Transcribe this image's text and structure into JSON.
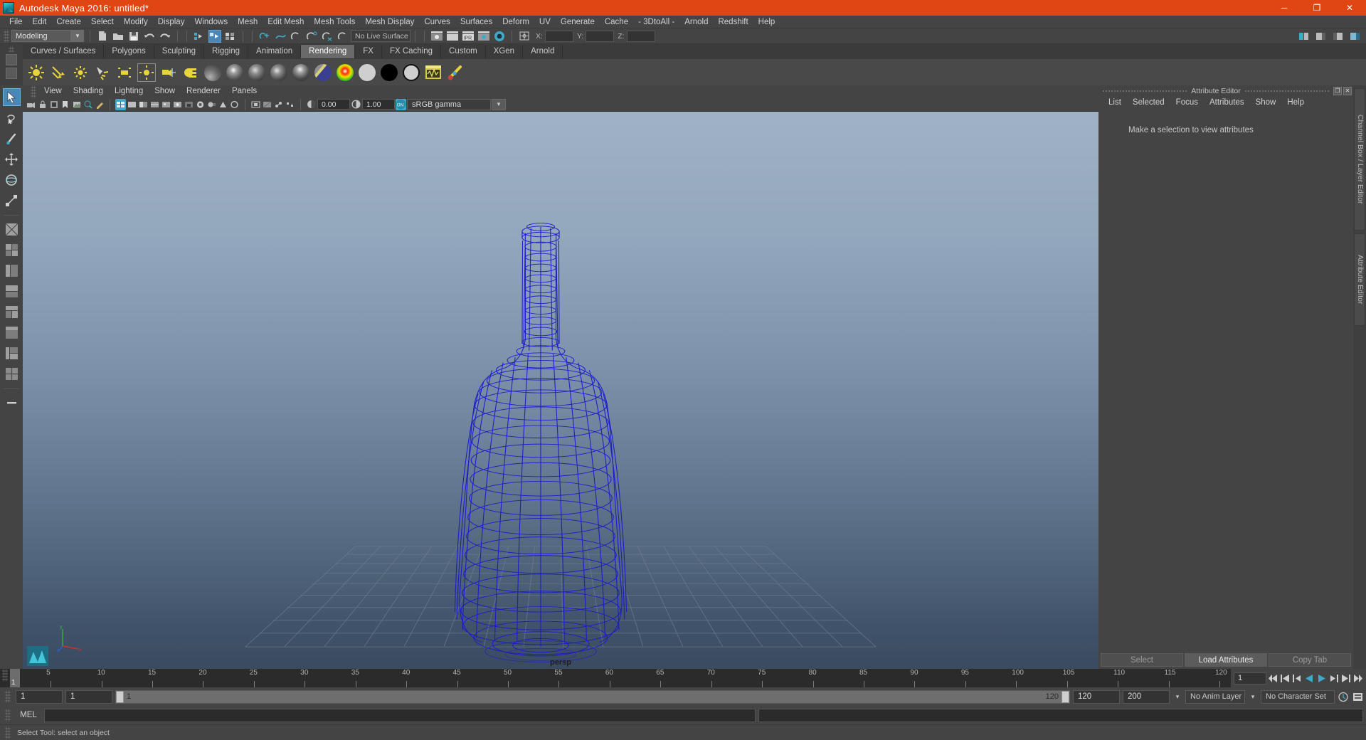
{
  "titlebar": {
    "title": "Autodesk Maya 2016: untitled*",
    "logo_icon": "maya-logo-icon",
    "minimize": "─",
    "maximize": "❐",
    "close": "✕"
  },
  "menubar": {
    "items": [
      {
        "label": "File"
      },
      {
        "label": "Edit"
      },
      {
        "label": "Create"
      },
      {
        "label": "Select"
      },
      {
        "label": "Modify"
      },
      {
        "label": "Display"
      },
      {
        "label": "Windows"
      },
      {
        "label": "Mesh"
      },
      {
        "label": "Edit Mesh"
      },
      {
        "label": "Mesh Tools"
      },
      {
        "label": "Mesh Display"
      },
      {
        "label": "Curves"
      },
      {
        "label": "Surfaces"
      },
      {
        "label": "Deform"
      },
      {
        "label": "UV"
      },
      {
        "label": "Generate"
      },
      {
        "label": "Cache"
      },
      {
        "label": "- 3DtoAll -"
      },
      {
        "label": "Arnold"
      },
      {
        "label": "Redshift"
      },
      {
        "label": "Help"
      }
    ]
  },
  "statusbar": {
    "mode": "Modeling",
    "mode_arrow": "▼",
    "live_surface": "No Live Surface",
    "coords": {
      "x_label": "X:",
      "x_value": "",
      "y_label": "Y:",
      "y_value": "",
      "z_label": "Z:",
      "z_value": ""
    }
  },
  "shelf": {
    "tabs": [
      {
        "label": "Curves / Surfaces",
        "active": false
      },
      {
        "label": "Polygons",
        "active": false
      },
      {
        "label": "Sculpting",
        "active": false
      },
      {
        "label": "Rigging",
        "active": false
      },
      {
        "label": "Animation",
        "active": false
      },
      {
        "label": "Rendering",
        "active": true
      },
      {
        "label": "FX",
        "active": false
      },
      {
        "label": "FX Caching",
        "active": false
      },
      {
        "label": "Custom",
        "active": false
      },
      {
        "label": "XGen",
        "active": false
      },
      {
        "label": "Arnold",
        "active": false
      }
    ]
  },
  "panel_menu": {
    "items": [
      {
        "label": "View"
      },
      {
        "label": "Shading"
      },
      {
        "label": "Lighting"
      },
      {
        "label": "Show"
      },
      {
        "label": "Renderer"
      },
      {
        "label": "Panels"
      }
    ]
  },
  "panel_toolbar": {
    "exposure_value": "0.00",
    "gamma_value": "1.00",
    "color_management": "sRGB gamma",
    "dropdown_arrow": "▼"
  },
  "viewport": {
    "camera_label": "persp",
    "axis": {
      "x": "x",
      "y": "y",
      "z": "z"
    },
    "object": "wireframe-bottle",
    "wire_color": "#1a1acc"
  },
  "attribute_editor": {
    "title": "Attribute Editor",
    "restore_icon": "❐",
    "close_icon": "✕",
    "menu": [
      {
        "label": "List"
      },
      {
        "label": "Selected"
      },
      {
        "label": "Focus"
      },
      {
        "label": "Attributes"
      },
      {
        "label": "Show"
      },
      {
        "label": "Help"
      }
    ],
    "message": "Make a selection to view attributes",
    "footer": [
      {
        "label": "Select",
        "enabled": false
      },
      {
        "label": "Load Attributes",
        "enabled": true
      },
      {
        "label": "Copy Tab",
        "enabled": false
      }
    ]
  },
  "side_tabs": [
    {
      "label": "Channel Box / Layer Editor"
    },
    {
      "label": "Attribute Editor"
    }
  ],
  "timeline": {
    "current_frame": "1",
    "ticks": [
      5,
      10,
      15,
      20,
      25,
      30,
      35,
      40,
      45,
      50,
      55,
      60,
      65,
      70,
      75,
      80,
      85,
      90,
      95,
      100,
      105,
      110,
      115,
      120
    ],
    "start_tick": 1,
    "end_tick": 120,
    "frame_field": "1",
    "playback_buttons": [
      "go-to-start",
      "step-back-key",
      "step-back-frame",
      "play-backwards",
      "play-forwards",
      "step-forward-frame",
      "step-forward-key",
      "go-to-end"
    ]
  },
  "range": {
    "anim_start": "1",
    "range_start": "1",
    "slider_left_label": "1",
    "slider_right_label": "120",
    "range_end": "120",
    "anim_end": "200",
    "anim_layer": "No Anim Layer",
    "character_set": "No Character Set",
    "arrow": "▾"
  },
  "mel": {
    "label": "MEL",
    "command_value": "",
    "output_value": ""
  },
  "helpline": {
    "text": "Select Tool: select an object"
  },
  "colors": {
    "title_bg": "#e04613",
    "app_bg": "#444444",
    "accent_blue": "#4a87b8",
    "cyan": "#3fa9c9",
    "shelf_active": "#6a6a6a",
    "wire": "#1a1acc"
  }
}
